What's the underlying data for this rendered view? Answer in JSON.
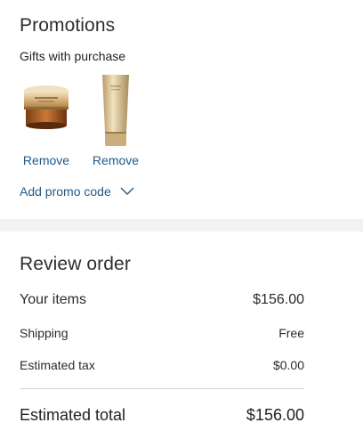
{
  "promotions": {
    "title": "Promotions",
    "gifts_label": "Gifts with purchase",
    "gifts": [
      {
        "icon": "cream-jar-image",
        "remove_label": "Remove"
      },
      {
        "icon": "cleanser-tube-image",
        "remove_label": "Remove"
      }
    ],
    "promo_code_label": "Add promo code",
    "link_color": "#1f5a8a"
  },
  "review": {
    "title": "Review order",
    "rows": [
      {
        "label": "Your items",
        "value": "$156.00"
      },
      {
        "label": "Shipping",
        "value": "Free"
      },
      {
        "label": "Estimated tax",
        "value": "$0.00"
      }
    ],
    "total": {
      "label": "Estimated total",
      "value": "$156.00"
    }
  }
}
